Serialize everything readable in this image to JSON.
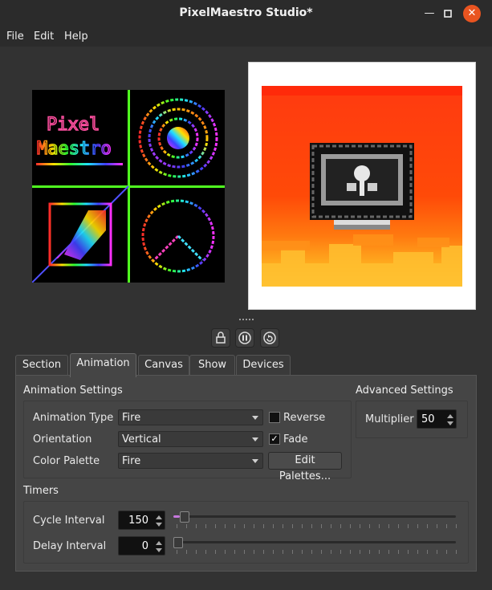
{
  "window": {
    "title": "PixelMaestro Studio*",
    "minimize_icon": "minimize-icon",
    "maximize_icon": "maximize-icon",
    "close_icon": "close-icon"
  },
  "menu": {
    "file": "File",
    "edit": "Edit",
    "help": "Help"
  },
  "preview": {
    "left_text_line1": "Pixel",
    "left_text_line2": "Maestro"
  },
  "controls": {
    "lock_icon": "lock-icon",
    "pause_icon": "pause-icon",
    "sync_icon": "sync-icon"
  },
  "tabs": [
    "Section",
    "Animation",
    "Canvas",
    "Show",
    "Devices"
  ],
  "animation_settings": {
    "title": "Animation Settings",
    "type_label": "Animation Type",
    "type_value": "Fire",
    "orientation_label": "Orientation",
    "orientation_value": "Vertical",
    "palette_label": "Color Palette",
    "palette_value": "Fire",
    "reverse_label": "Reverse",
    "reverse_checked": false,
    "fade_label": "Fade",
    "fade_checked": true,
    "edit_palettes": "Edit Palettes..."
  },
  "advanced_settings": {
    "title": "Advanced Settings",
    "multiplier_label": "Multiplier",
    "multiplier_value": "50"
  },
  "timers": {
    "title": "Timers",
    "cycle_label": "Cycle Interval",
    "cycle_value": "150",
    "delay_label": "Delay Interval",
    "delay_value": "0"
  },
  "colors": {
    "accent": "#c678dd",
    "close_button": "#e95420"
  }
}
